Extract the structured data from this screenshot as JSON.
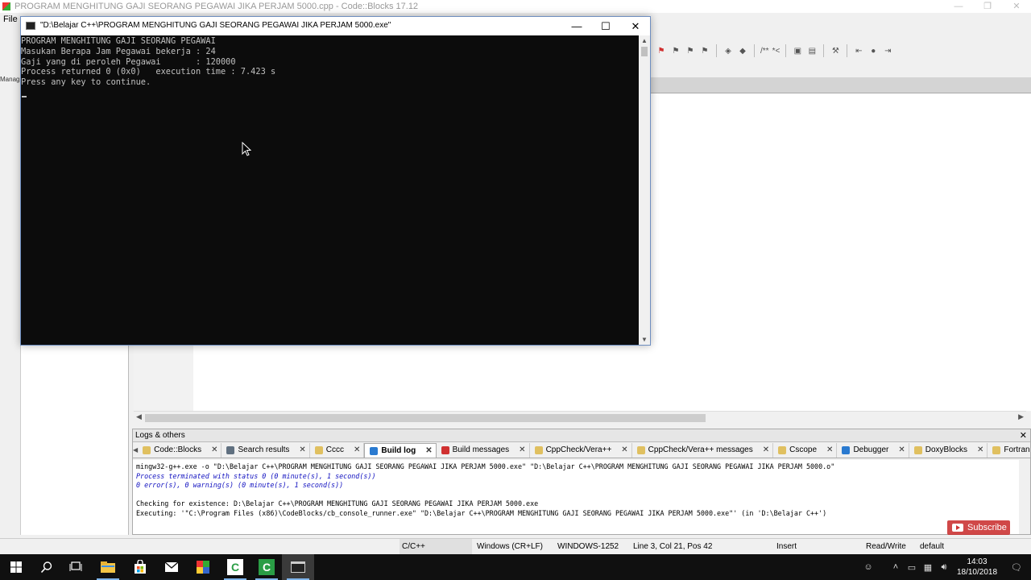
{
  "ide": {
    "title": "PROGRAM MENGHITUNG GAJI SEORANG PEGAWAI JIKA PERJAM 5000.cpp - Code::Blocks 17.12",
    "menu_file": "File",
    "left_label": "Manag"
  },
  "console": {
    "title": "\"D:\\Belajar C++\\PROGRAM MENGHITUNG GAJI SEORANG PEGAWAI JIKA PERJAM 5000.exe\"",
    "lines": [
      "PROGRAM MENGHITUNG GAJI SEORANG PEGAWAI",
      "Masukan Berapa Jam Pegawai bekerja : 24",
      "Gaji yang di peroleh Pegawai       : 120000",
      "Process returned 0 (0x0)   execution time : 7.423 s",
      "Press any key to continue."
    ]
  },
  "logs": {
    "header": "Logs & others",
    "tabs": [
      {
        "label": "Code::Blocks",
        "icon": "document-icon",
        "color": "#e0c060"
      },
      {
        "label": "Search results",
        "icon": "magnifier-icon",
        "color": "#607080"
      },
      {
        "label": "Cccc",
        "icon": "document-icon",
        "color": "#e0c060"
      },
      {
        "label": "Build log",
        "icon": "gear-icon",
        "color": "#2a7ad0"
      },
      {
        "label": "Build messages",
        "icon": "flag-icon",
        "color": "#d03030"
      },
      {
        "label": "CppCheck/Vera++",
        "icon": "document-icon",
        "color": "#e0c060"
      },
      {
        "label": "CppCheck/Vera++ messages",
        "icon": "document-icon",
        "color": "#e0c060"
      },
      {
        "label": "Cscope",
        "icon": "document-icon",
        "color": "#e0c060"
      },
      {
        "label": "Debugger",
        "icon": "gear-icon",
        "color": "#2a7ad0"
      },
      {
        "label": "DoxyBlocks",
        "icon": "document-icon",
        "color": "#e0c060"
      },
      {
        "label": "Fortran in",
        "icon": "document-icon",
        "color": "#e0c060"
      }
    ],
    "lines": [
      {
        "text": "mingw32-g++.exe  -o \"D:\\Belajar C++\\PROGRAM MENGHITUNG GAJI SEORANG PEGAWAI JIKA PERJAM 5000.exe\" \"D:\\Belajar C++\\PROGRAM MENGHITUNG GAJI SEORANG PEGAWAI JIKA PERJAM 5000.o\"",
        "style": "normal"
      },
      {
        "text": "Process terminated with status 0 (0 minute(s), 1 second(s))",
        "style": "blue"
      },
      {
        "text": "0 error(s), 0 warning(s) (0 minute(s), 1 second(s))",
        "style": "blue"
      },
      {
        "text": "",
        "style": "normal"
      },
      {
        "text": "Checking for existence: D:\\Belajar C++\\PROGRAM MENGHITUNG GAJI SEORANG PEGAWAI JIKA PERJAM 5000.exe",
        "style": "normal"
      },
      {
        "text": "Executing: '\"C:\\Program Files (x86)\\CodeBlocks/cb_console_runner.exe\" \"D:\\Belajar C++\\PROGRAM MENGHITUNG GAJI SEORANG PEGAWAI JIKA PERJAM 5000.exe\"' (in 'D:\\Belajar C++')",
        "style": "normal"
      }
    ]
  },
  "overlay": {
    "subscribe": "Subscribe"
  },
  "status": {
    "language": "C/C++",
    "line_endings": "Windows (CR+LF)",
    "encoding": "WINDOWS-1252",
    "position": "Line 3, Col 21, Pos 42",
    "mode": "Insert",
    "access": "Read/Write",
    "profile": "default"
  },
  "taskbar": {
    "time": "14:03",
    "date": "18/10/2018"
  },
  "colors": {
    "console_bg": "#0c0c0c",
    "console_text": "#c0c0c0",
    "taskbar_bg": "#101010",
    "accent": "#7eb4ea"
  }
}
